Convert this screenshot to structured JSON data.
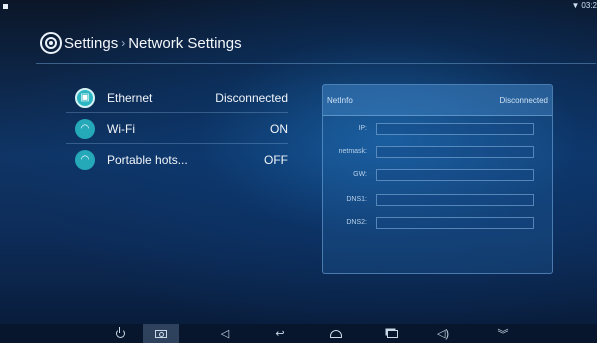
{
  "status_bar": {
    "time": "03:2"
  },
  "header": {
    "title": "Settings",
    "separator": "›",
    "subtitle": "Network Settings"
  },
  "network_list": [
    {
      "icon": "ethernet-icon",
      "label": "Ethernet",
      "value": "Disconnected"
    },
    {
      "icon": "wifi-icon",
      "label": "Wi-Fi",
      "value": "ON"
    },
    {
      "icon": "hotspot-icon",
      "label": "Portable hots...",
      "value": "OFF"
    }
  ],
  "netinfo": {
    "title": "NetInfo",
    "status": "Disconnected",
    "fields": [
      {
        "label": "IP:",
        "value": ""
      },
      {
        "label": "netmask:",
        "value": ""
      },
      {
        "label": "GW:",
        "value": ""
      },
      {
        "label": "DNS1:",
        "value": ""
      },
      {
        "label": "DNS2:",
        "value": ""
      }
    ]
  },
  "nav_bar": {
    "buttons": [
      "power-icon",
      "screenshot-icon",
      "volume-down-icon",
      "back-icon",
      "home-icon",
      "recent-apps-icon",
      "volume-up-icon",
      "collapse-icon"
    ],
    "active": "screenshot-icon"
  },
  "colors": {
    "accent": "#25a9b8",
    "background": "#0f3566",
    "navbar": "#07162c"
  }
}
